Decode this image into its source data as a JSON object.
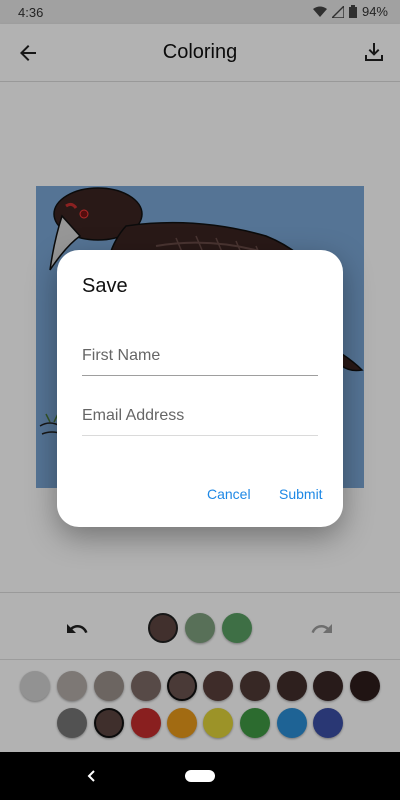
{
  "status_bar": {
    "time": "4:36",
    "battery": "94%"
  },
  "app_bar": {
    "title": "Coloring",
    "back_icon": "arrow-back-icon",
    "download_icon": "download-icon"
  },
  "controls": {
    "recent_colors": [
      "#5d4541",
      "#7ea17e",
      "#5aa064"
    ],
    "palette_row1": [
      "#d2d2d2",
      "#b3aca8",
      "#9b918c",
      "#7d6b66",
      "#6b5350",
      "#5a403b",
      "#4f3a36",
      "#432e2c",
      "#3a2826",
      "#2f1e1c"
    ],
    "palette_row2": [
      "#767676",
      "#5b4440",
      "#c52d2d",
      "#e89a1b",
      "#e0d33a",
      "#3f9a44",
      "#2b8fd6",
      "#3c4fa6"
    ],
    "selected_palette_indices_row1": [
      4
    ],
    "selected_palette_indices_row2": [
      1
    ]
  },
  "dialog": {
    "title": "Save",
    "first_name_placeholder": "First Name",
    "email_placeholder": "Email Address",
    "cancel_label": "Cancel",
    "submit_label": "Submit"
  }
}
